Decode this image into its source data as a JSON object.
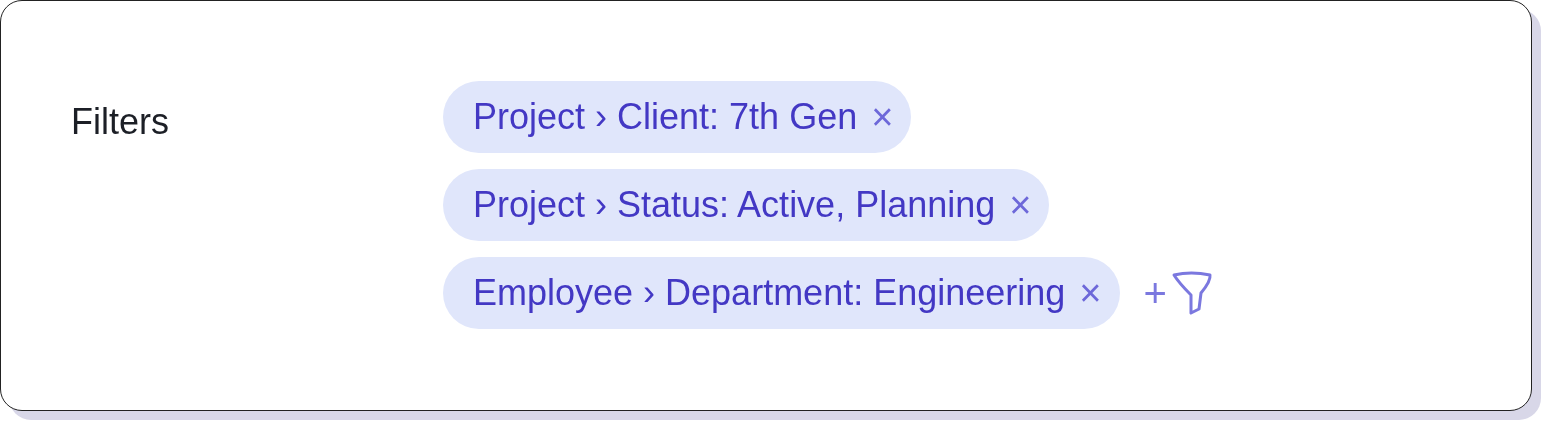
{
  "label": "Filters",
  "filters": [
    {
      "text": "Project › Client: 7th Gen",
      "remove": "×"
    },
    {
      "text": "Project › Status: Active, Planning",
      "remove": "×"
    },
    {
      "text": "Employee › Department: Engineering",
      "remove": "×"
    }
  ],
  "add_button": {
    "text": "+"
  }
}
